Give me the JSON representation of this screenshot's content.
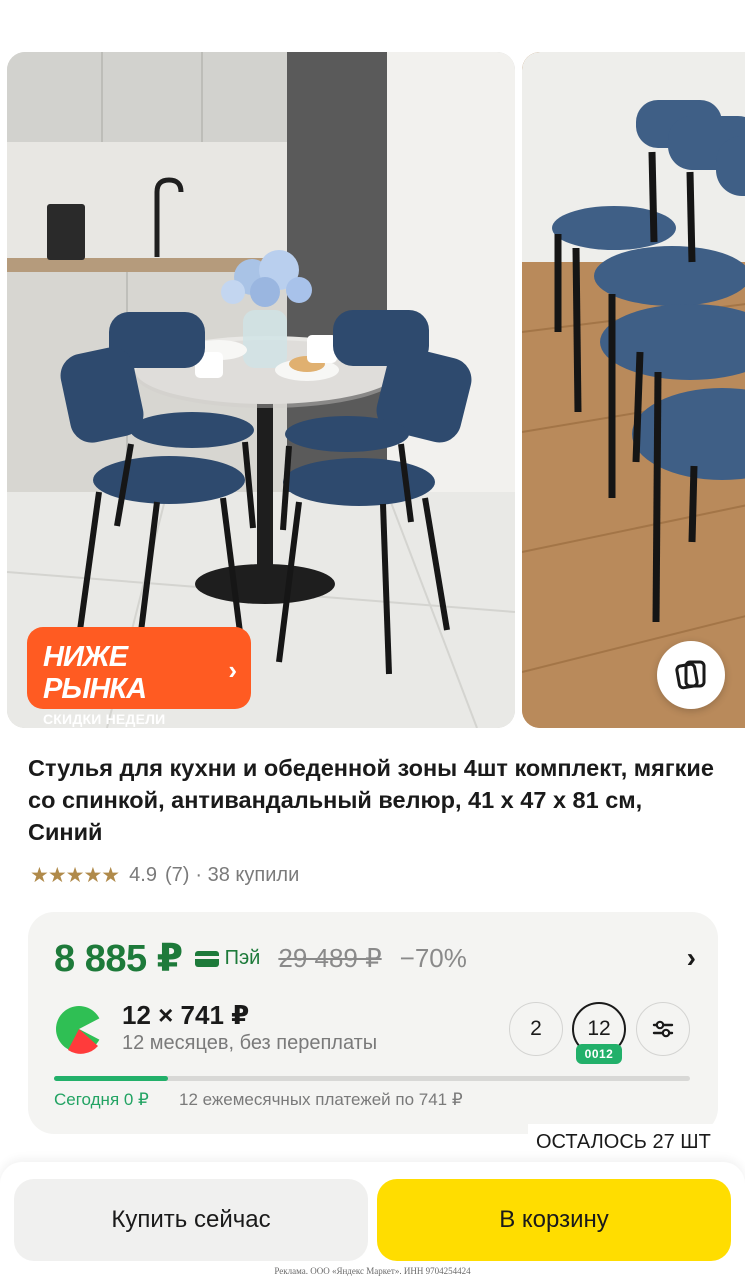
{
  "gallery": {
    "promo_title": "НИЖЕ РЫНКА",
    "promo_subtitle": "СКИДКИ НЕДЕЛИ",
    "ar_icon": "ar-view-icon"
  },
  "product": {
    "title": "Стулья для кухни и обеденной зоны 4шт комплект, мягкие со спинкой, антивандальный велюр, 41 x 47 x 81 см, Синий",
    "rating_stars": "★★★★★",
    "rating_value": "4.9",
    "rating_count": "(7)",
    "bought": "· 38 купили"
  },
  "price": {
    "current": "8 885 ₽",
    "pay_label": "Пэй",
    "old": "29 489 ₽",
    "discount": "−70%"
  },
  "installment": {
    "amount": "12 × 741 ₽",
    "description": "12 месяцев, без переплаты",
    "terms": [
      "2",
      "12"
    ],
    "selected_term": "12",
    "badge": "0012",
    "progress_fraction": 0.18,
    "today_label": "Сегодня 0 ₽",
    "rest_label": "12 ежемесячных платежей по 741 ₽"
  },
  "stock": {
    "label": "ОСТАЛОСЬ 27 ШТ"
  },
  "actions": {
    "buy_now": "Купить сейчас",
    "add_to_cart": "В корзину"
  },
  "footer": {
    "ad_note": "Реклама. ООО «Яндекс Маркет». ИНН 9704254424"
  },
  "colors": {
    "price_green": "#1d7a3a",
    "accent_green": "#22b06a",
    "promo_orange": "#ff5b22",
    "cart_yellow": "#ffdd00"
  }
}
